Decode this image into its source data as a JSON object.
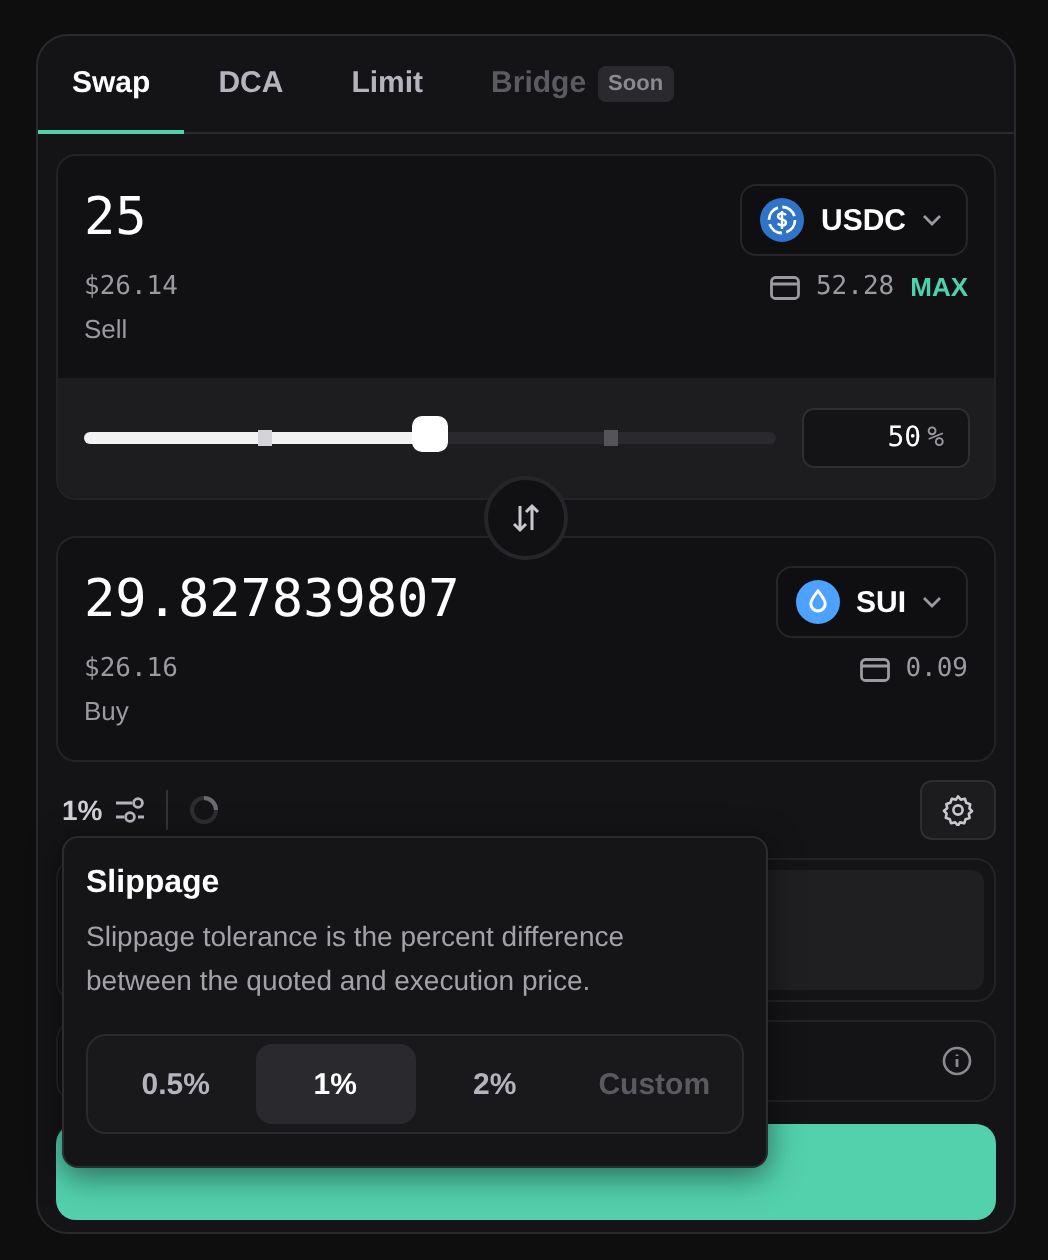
{
  "tabs": [
    {
      "label": "Swap",
      "selected": true,
      "disabled": false
    },
    {
      "label": "DCA",
      "selected": false,
      "disabled": false
    },
    {
      "label": "Limit",
      "selected": false,
      "disabled": false
    },
    {
      "label": "Bridge",
      "selected": false,
      "disabled": true,
      "badge": "Soon"
    }
  ],
  "sell": {
    "amount": "25",
    "usd_value": "$26.14",
    "label": "Sell",
    "token": "USDC",
    "kind": "usdc",
    "balance": "52.28",
    "max": "MAX"
  },
  "slider": {
    "level": 0.5,
    "reading": "50",
    "unit": "%"
  },
  "buy": {
    "amount": "29.827839807",
    "usd_value": "$26.16",
    "label": "Buy",
    "token": "SUI",
    "kind": "sui",
    "balance": "0.09"
  },
  "slippage_setting": "1%",
  "popover": {
    "title": "Slippage",
    "description": "Slippage tolerance is the percent difference between the quoted and execution price.",
    "options": [
      {
        "label": "0.5%",
        "selected": false,
        "disabled": false
      },
      {
        "label": "1%",
        "selected": true,
        "disabled": false
      },
      {
        "label": "2%",
        "selected": false,
        "disabled": false
      },
      {
        "label": "Custom",
        "selected": false,
        "disabled": true
      }
    ]
  }
}
